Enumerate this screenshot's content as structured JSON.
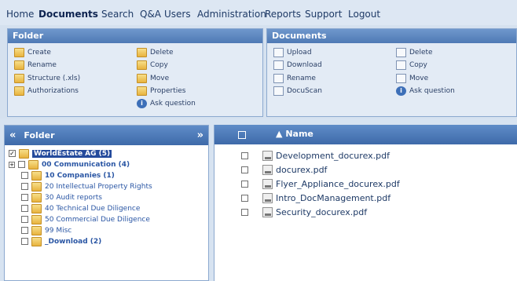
{
  "menu": [
    "Home",
    "Documents",
    "Search",
    "Q&A",
    "Users",
    "Administration",
    "Reports",
    "Support",
    "Logout"
  ],
  "folder_panel": {
    "title": "Folder",
    "actions_left": [
      "Create",
      "Rename",
      "Structure (.xls)",
      "Authorizations"
    ],
    "actions_right": [
      "Delete",
      "Copy",
      "Move",
      "Properties",
      "Ask question"
    ]
  },
  "documents_panel": {
    "title": "Documents",
    "actions_left": [
      "Upload",
      "Download",
      "Rename",
      "DocuScan"
    ],
    "actions_right": [
      "Delete",
      "Copy",
      "Move",
      "Ask question"
    ]
  },
  "tree": {
    "title": "Folder",
    "collapse_glyph": "«",
    "expand_glyph": "»",
    "items": [
      {
        "label": "WorldEstate AG (5)"
      },
      {
        "label": "00 Communication (4)"
      },
      {
        "label": "10 Companies (1)"
      },
      {
        "label": "20 Intellectual Property Rights"
      },
      {
        "label": "30 Audit reports"
      },
      {
        "label": "40 Technical Due Diligence"
      },
      {
        "label": "50 Commercial Due Diligence"
      },
      {
        "label": "99 Misc"
      },
      {
        "label": "_Download (2)"
      }
    ]
  },
  "documents": {
    "column_name": "Name",
    "sort_glyph": "▲",
    "files": [
      "Development_docurex.pdf",
      "docurex.pdf",
      "Flyer_Appliance_docurex.pdf",
      "Intro_DocManagement.pdf",
      "Security_docurex.pdf"
    ]
  }
}
